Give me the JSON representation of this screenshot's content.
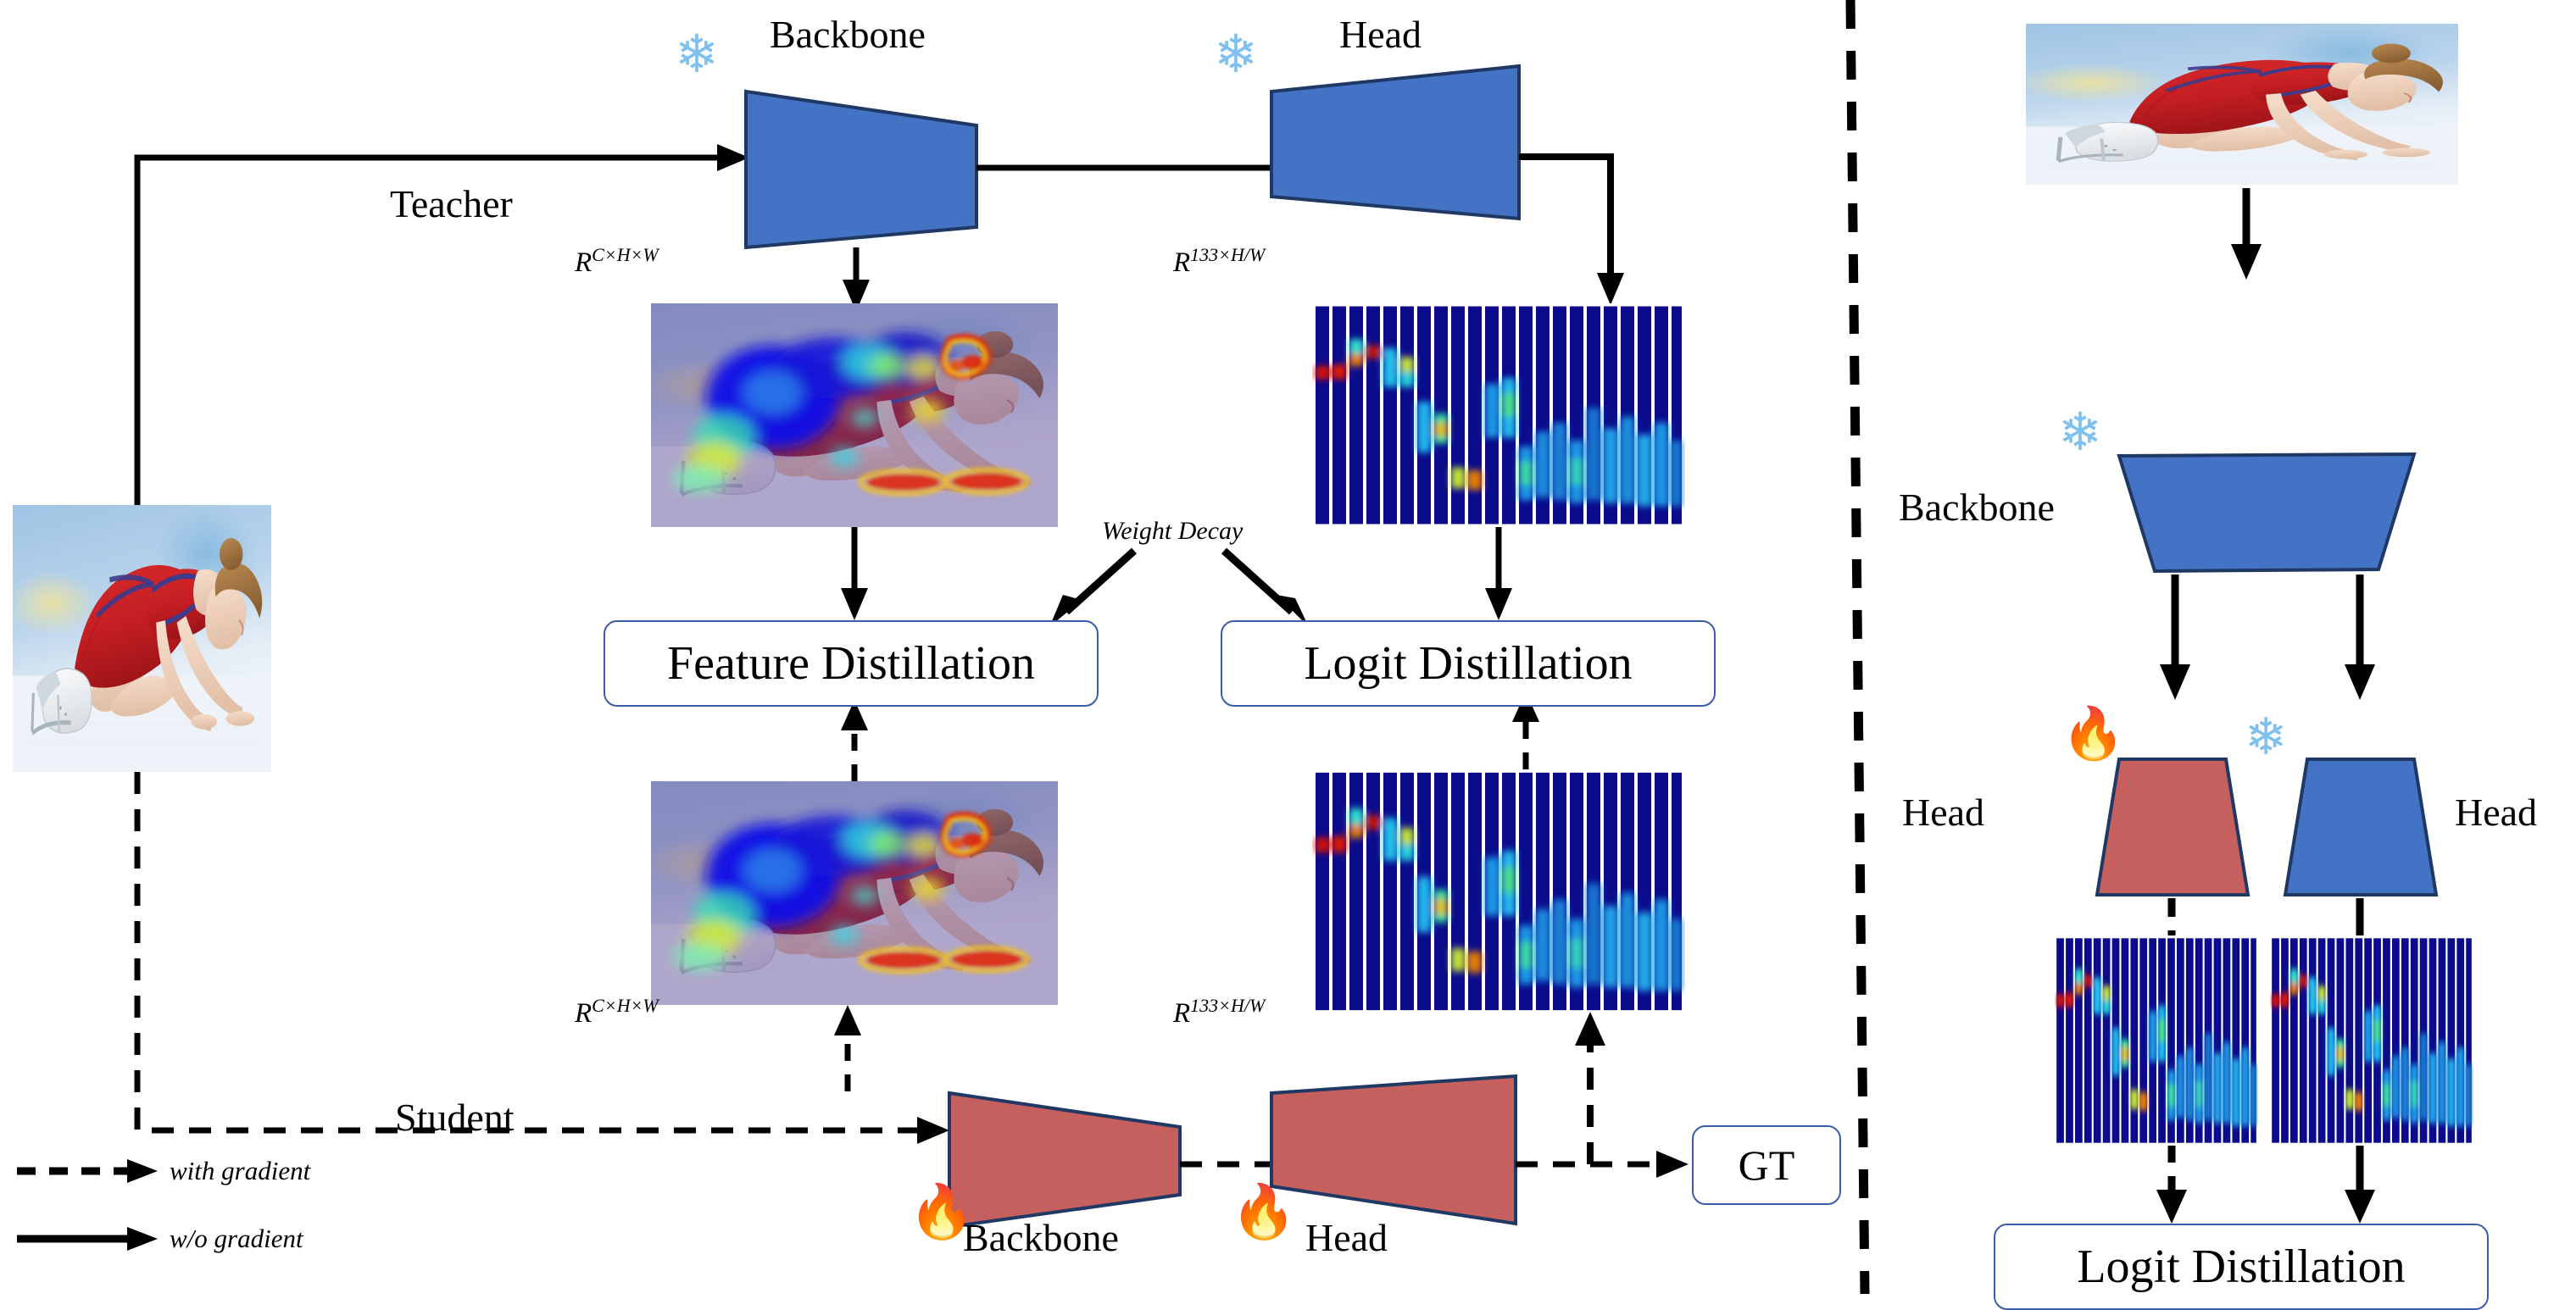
{
  "figure": {
    "title": "Knowledge distillation framework diagram",
    "colors": {
      "teacher_block": "#4472C4",
      "student_block": "#C5605E",
      "block_stroke": "#1F3864",
      "box_stroke": "#3A5DA8",
      "arrow": "#000000",
      "snowflake": "#7EC0F0",
      "fire": "#F2572A",
      "divider": "#000000"
    }
  },
  "left_panel": {
    "teacher_branch_label": "Teacher",
    "student_branch_label": "Student",
    "teacher_backbone_label": "Backbone",
    "teacher_head_label": "Head",
    "student_backbone_label": "Backbone",
    "student_head_label": "Head",
    "teacher_feature_shape": "R",
    "teacher_feature_shape_sup": "C×H×W",
    "teacher_logit_shape": "R",
    "teacher_logit_shape_sup": "133×H/W",
    "student_feature_shape": "R",
    "student_feature_shape_sup": "C×H×W",
    "student_logit_shape": "R",
    "student_logit_shape_sup": "133×H/W",
    "weight_decay_label": "Weight Decay",
    "feature_distillation_label": "Feature Distillation",
    "logit_distillation_label": "Logit Distillation",
    "gt_label": "GT",
    "input_image_caption": "figure-skater-kneeling-on-ice",
    "teacher_feature_map_caption": "teacher-feature-heatmap-overlay",
    "student_feature_map_caption": "student-feature-heatmap-overlay",
    "teacher_logit_map_caption": "teacher-logit-heatmap",
    "student_logit_map_caption": "student-logit-heatmap",
    "frozen_icon": "snowflake",
    "trainable_icon": "fire"
  },
  "legend": {
    "items": [
      {
        "style": "dashed",
        "label": "with gradient"
      },
      {
        "style": "solid",
        "label": "w/o gradient"
      }
    ]
  },
  "right_panel": {
    "input_image_caption": "figure-skater-kneeling-on-ice",
    "backbone_label": "Backbone",
    "student_head_label": "Head",
    "teacher_head_label": "Head",
    "logit_distillation_label": "Logit Distillation",
    "student_logit_map_caption": "student-logit-heatmap",
    "teacher_logit_map_caption": "teacher-logit-heatmap",
    "frozen_icon": "snowflake",
    "trainable_icon": "fire"
  }
}
